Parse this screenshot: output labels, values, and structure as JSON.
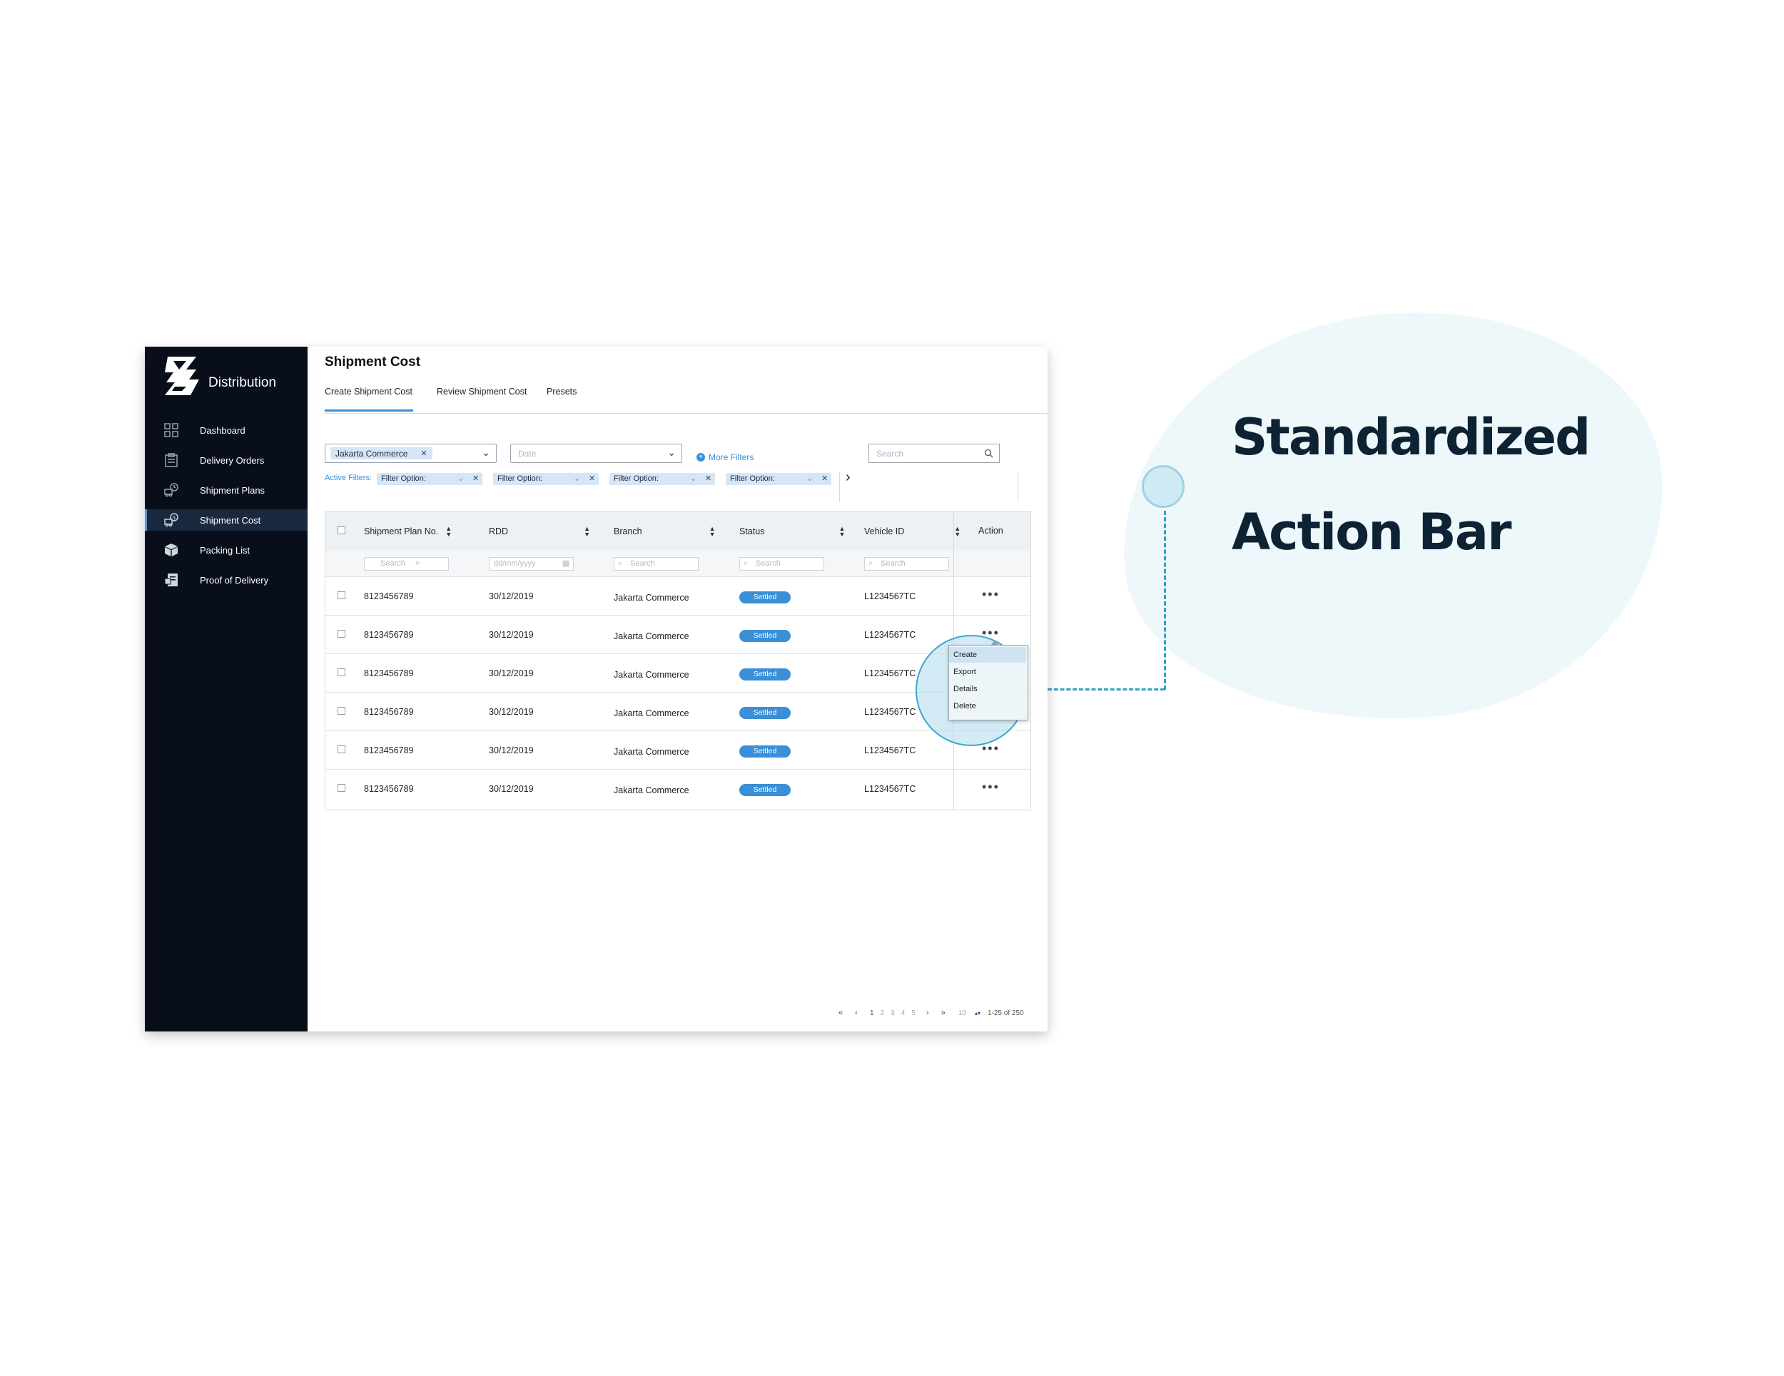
{
  "brand": {
    "name": "Distribution"
  },
  "sidebar": {
    "items": [
      {
        "label": "Dashboard",
        "icon": "grid-icon"
      },
      {
        "label": "Delivery Orders",
        "icon": "clipboard-icon"
      },
      {
        "label": "Shipment Plans",
        "icon": "truck-clock-icon"
      },
      {
        "label": "Shipment Cost",
        "icon": "truck-dollar-icon",
        "active": true
      },
      {
        "label": "Packing List",
        "icon": "box-icon"
      },
      {
        "label": "Proof of Delivery",
        "icon": "document-icon"
      }
    ]
  },
  "page": {
    "title": "Shipment Cost"
  },
  "tabs": [
    {
      "label": "Create Shipment Cost",
      "active": true
    },
    {
      "label": "Review Shipment Cost"
    },
    {
      "label": "Presets"
    }
  ],
  "filters": {
    "branch_chip": "Jakarta Commerce",
    "date_placeholder": "Date",
    "more_filters": "More Filters",
    "search_placeholder": "Search",
    "active_label": "Active Filters:",
    "active_chips": [
      "Filter Option:",
      "Filter Option:",
      "Filter Option:",
      "Filter Option:"
    ]
  },
  "table": {
    "headers": [
      "Shipment Plan No.",
      "RDD",
      "Branch",
      "Status",
      "Vehicle ID",
      "Action"
    ],
    "filter_placeholders": [
      "Search",
      "dd/mm/yyyy",
      "Search",
      "Search",
      "Search"
    ],
    "rows": [
      {
        "plan": "8123456789",
        "rdd": "30/12/2019",
        "branch": "Jakarta Commerce",
        "status": "Settled",
        "vehicle": "L1234567TC"
      },
      {
        "plan": "8123456789",
        "rdd": "30/12/2019",
        "branch": "Jakarta Commerce",
        "status": "Settled",
        "vehicle": "L1234567TC"
      },
      {
        "plan": "8123456789",
        "rdd": "30/12/2019",
        "branch": "Jakarta Commerce",
        "status": "Settled",
        "vehicle": "L1234567TC"
      },
      {
        "plan": "8123456789",
        "rdd": "30/12/2019",
        "branch": "Jakarta Commerce",
        "status": "Settled",
        "vehicle": "L1234567TC"
      },
      {
        "plan": "8123456789",
        "rdd": "30/12/2019",
        "branch": "Jakarta Commerce",
        "status": "Settled",
        "vehicle": "L1234567TC"
      },
      {
        "plan": "8123456789",
        "rdd": "30/12/2019",
        "branch": "Jakarta Commerce",
        "status": "Settled",
        "vehicle": "L1234567TC"
      }
    ]
  },
  "action_menu": {
    "items": [
      "Create",
      "Export",
      "Details",
      "Delete"
    ],
    "highlighted": "Create"
  },
  "pagination": {
    "pages": [
      "1",
      "2",
      "3",
      "4",
      "5"
    ],
    "per_page": "10",
    "range": "1-25 of 250"
  },
  "callout": {
    "line1": "Standardized",
    "line2": "Action Bar"
  },
  "colors": {
    "accent": "#3a8fd6",
    "sidebar": "#080f1a",
    "callout_text": "#0d2233",
    "connector": "#2e9fca"
  }
}
